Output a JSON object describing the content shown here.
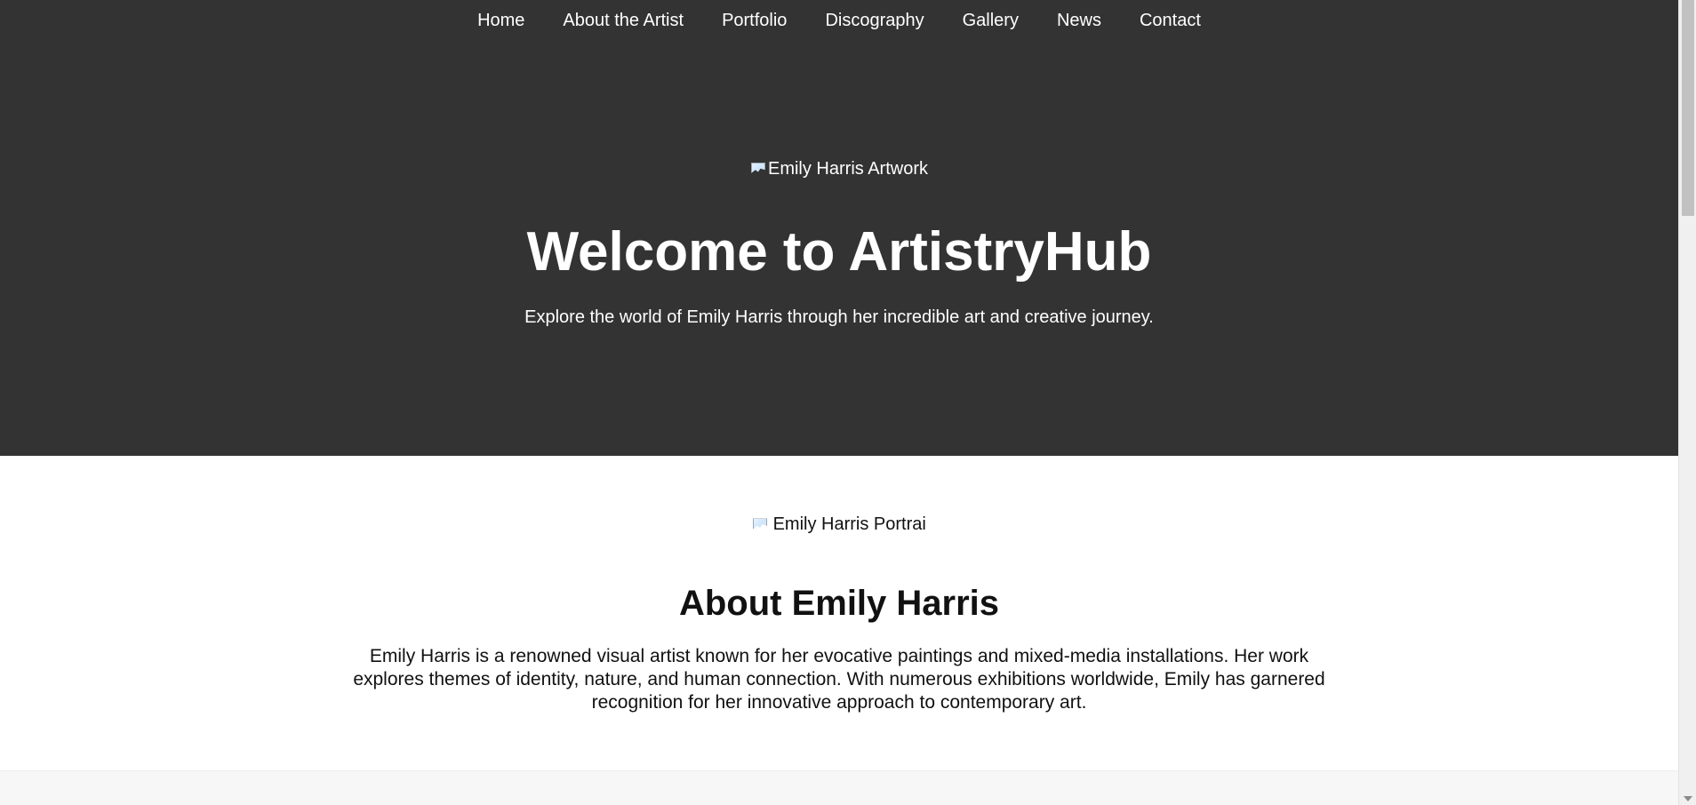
{
  "nav": {
    "items": [
      {
        "label": "Home"
      },
      {
        "label": "About the Artist"
      },
      {
        "label": "Portfolio"
      },
      {
        "label": "Discography"
      },
      {
        "label": "Gallery"
      },
      {
        "label": "News"
      },
      {
        "label": "Contact"
      }
    ]
  },
  "hero": {
    "image_alt": "Emily Harris Artwork",
    "title": "Welcome to ArtistryHub",
    "subtitle": "Explore the world of Emily Harris through her incredible art and creative journey."
  },
  "about": {
    "image_alt": "Emily Harris Portrait",
    "title": "About Emily Harris",
    "text": "Emily Harris is a renowned visual artist known for her evocative paintings and mixed-media installations. Her work explores themes of identity, nature, and human connection. With numerous exhibitions worldwide, Emily has garnered recognition for her innovative approach to contemporary art."
  },
  "colors": {
    "hero_bg": "#333333",
    "hero_text": "#ffffff",
    "about_bg": "#ffffff",
    "next_section_bg": "#f7f7f7"
  },
  "icons": {
    "broken_image": "broken-image-icon",
    "scroll_down": "chevron-down-icon"
  }
}
